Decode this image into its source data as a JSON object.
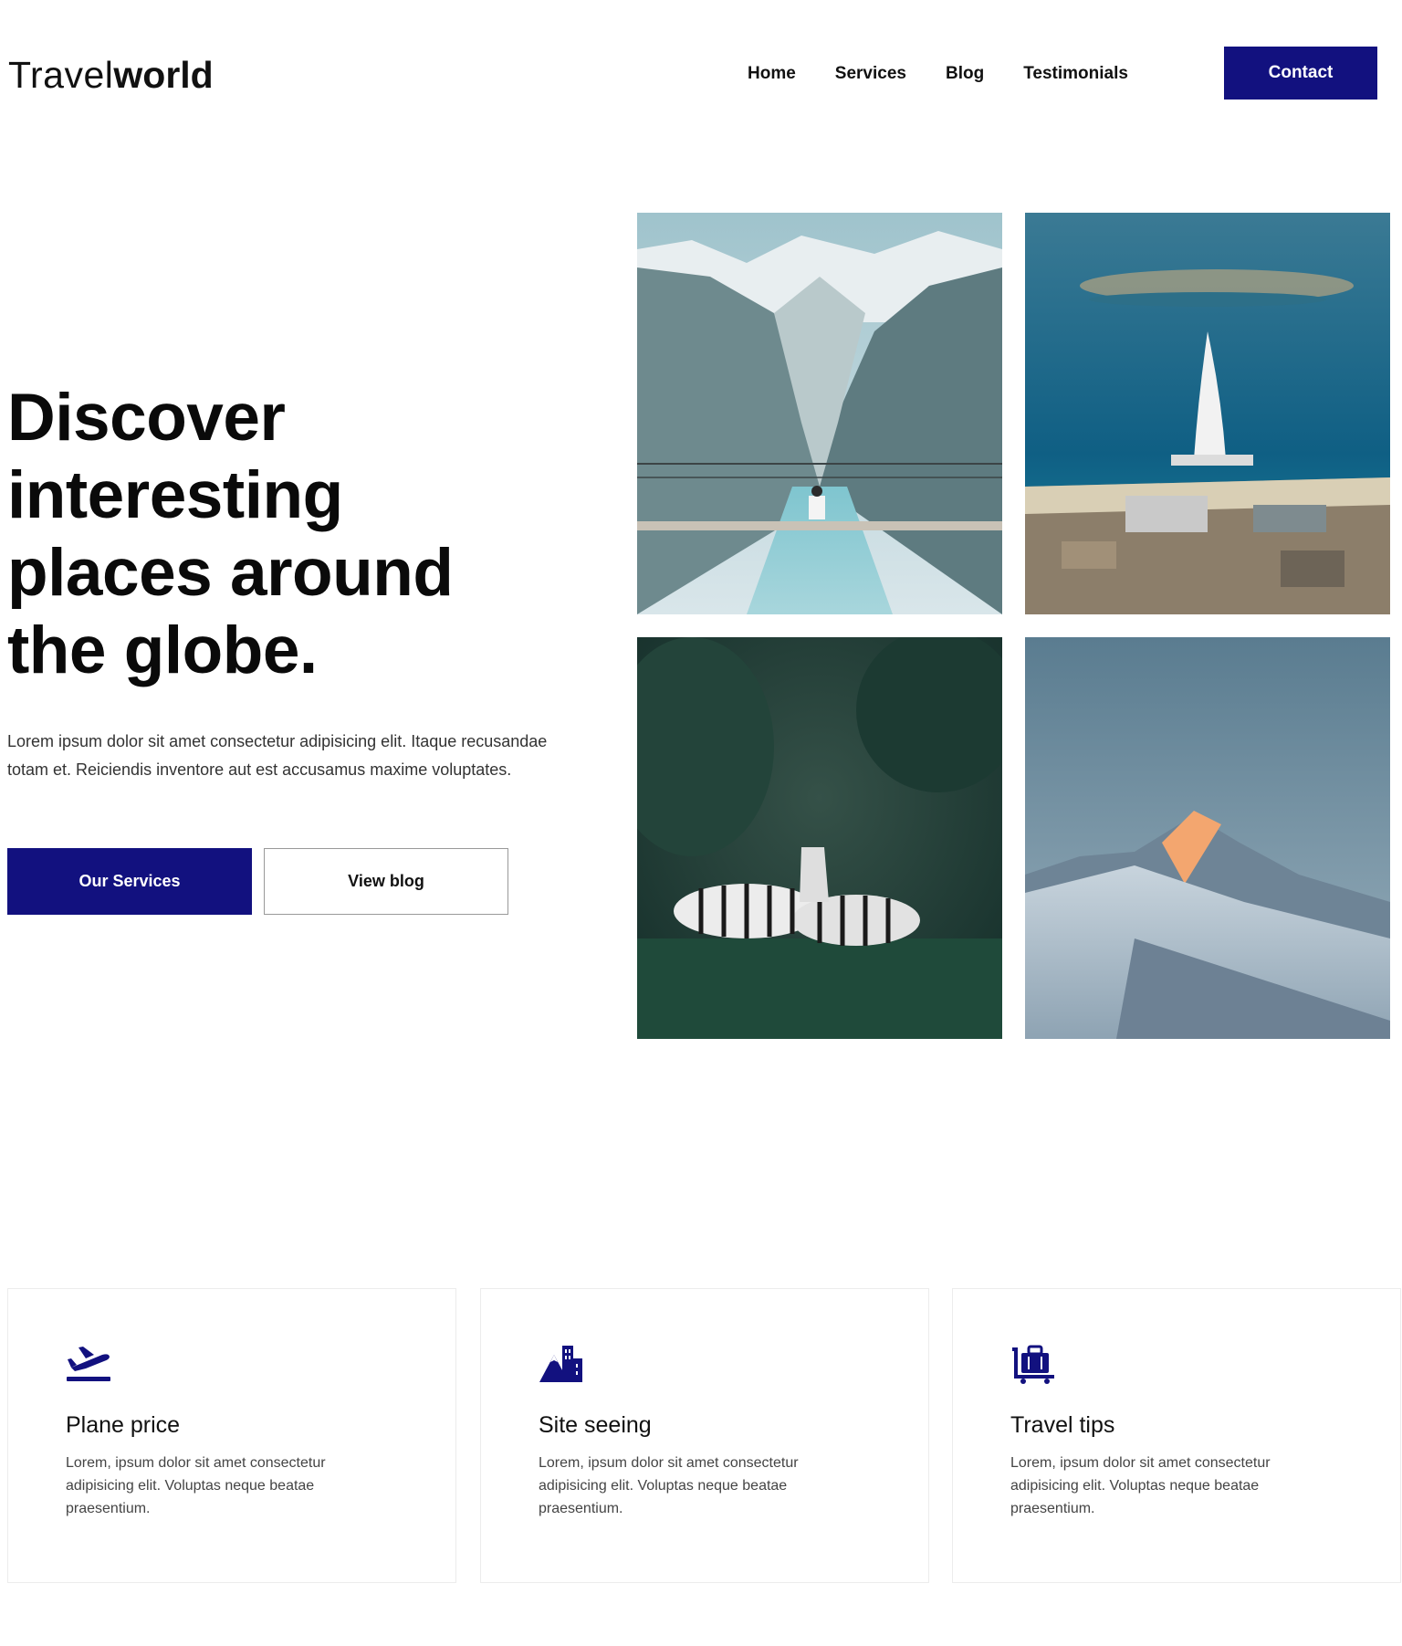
{
  "brand": {
    "light": "Travel",
    "bold": "world"
  },
  "nav": {
    "items": [
      "Home",
      "Services",
      "Blog",
      "Testimonials"
    ],
    "contact_label": "Contact"
  },
  "hero": {
    "title_lines": [
      "Discover",
      "interesting",
      "places around",
      "the globe."
    ],
    "description": "Lorem ipsum dolor sit amet consectetur adipisicing elit. Itaque recusandae totam et. Reiciendis inventore aut est accusamus maxime voluptates.",
    "primary_button": "Our Services",
    "secondary_button": "View blog"
  },
  "gallery": [
    "mountain-bridge-photo",
    "dubai-coast-photo",
    "zebras-photo",
    "snowy-peak-photo"
  ],
  "features": [
    {
      "icon": "plane-departure-icon",
      "title": "Plane price",
      "description": "Lorem, ipsum dolor sit amet consectetur adipisicing elit. Voluptas neque beatae praesentium."
    },
    {
      "icon": "mountain-city-icon",
      "title": "Site seeing",
      "description": "Lorem, ipsum dolor sit amet consectetur adipisicing elit. Voluptas neque beatae praesentium."
    },
    {
      "icon": "luggage-cart-icon",
      "title": "Travel tips",
      "description": "Lorem, ipsum dolor sit amet consectetur adipisicing elit. Voluptas neque beatae praesentium."
    }
  ],
  "colors": {
    "accent": "#12117f",
    "text": "#111111",
    "muted": "#444444"
  }
}
